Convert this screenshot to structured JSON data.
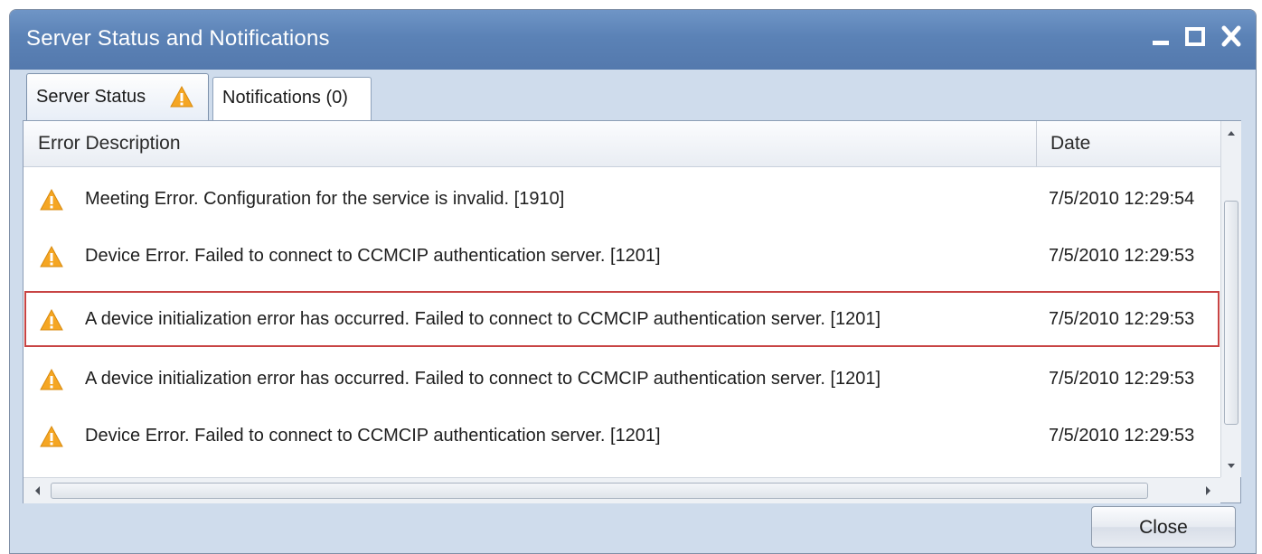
{
  "window": {
    "title": "Server Status and Notifications"
  },
  "tabs": [
    {
      "label": "Server Status",
      "icon": "warning-icon"
    },
    {
      "label": "Notifications (0)"
    }
  ],
  "table": {
    "columns": [
      "Error Description",
      "Date"
    ],
    "rows": [
      {
        "description": "Meeting Error. Configuration for the service is invalid. [1910]",
        "date": "7/5/2010 12:29:54"
      },
      {
        "description": "Device Error. Failed to connect to CCMCIP authentication server. [1201]",
        "date": "7/5/2010 12:29:53"
      },
      {
        "description": "A device initialization error has occurred. Failed to connect to CCMCIP authentication server. [1201]",
        "date": "7/5/2010 12:29:53",
        "selected": true
      },
      {
        "description": "A device initialization error has occurred. Failed to connect to CCMCIP authentication server. [1201]",
        "date": "7/5/2010 12:29:53"
      },
      {
        "description": "Device Error. Failed to connect to CCMCIP authentication server. [1201]",
        "date": "7/5/2010 12:29:53"
      }
    ]
  },
  "footer": {
    "close_label": "Close"
  },
  "colors": {
    "titlebar": "#5b82b6",
    "warning": "#f5a623",
    "selection_outline": "#c84444"
  }
}
